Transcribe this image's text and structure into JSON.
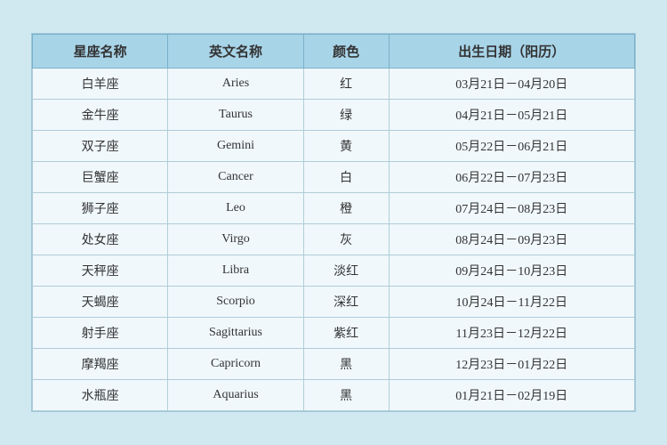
{
  "table": {
    "headers": [
      {
        "key": "chinese",
        "label": "星座名称"
      },
      {
        "key": "english",
        "label": "英文名称"
      },
      {
        "key": "color",
        "label": "颜色"
      },
      {
        "key": "date",
        "label": "出生日期（阳历）"
      }
    ],
    "rows": [
      {
        "chinese": "白羊座",
        "english": "Aries",
        "color": "红",
        "date": "03月21日－04月20日"
      },
      {
        "chinese": "金牛座",
        "english": "Taurus",
        "color": "绿",
        "date": "04月21日－05月21日"
      },
      {
        "chinese": "双子座",
        "english": "Gemini",
        "color": "黄",
        "date": "05月22日－06月21日"
      },
      {
        "chinese": "巨蟹座",
        "english": "Cancer",
        "color": "白",
        "date": "06月22日－07月23日"
      },
      {
        "chinese": "狮子座",
        "english": "Leo",
        "color": "橙",
        "date": "07月24日－08月23日"
      },
      {
        "chinese": "处女座",
        "english": "Virgo",
        "color": "灰",
        "date": "08月24日－09月23日"
      },
      {
        "chinese": "天秤座",
        "english": "Libra",
        "color": "淡红",
        "date": "09月24日－10月23日"
      },
      {
        "chinese": "天蝎座",
        "english": "Scorpio",
        "color": "深红",
        "date": "10月24日－11月22日"
      },
      {
        "chinese": "射手座",
        "english": "Sagittarius",
        "color": "紫红",
        "date": "11月23日－12月22日"
      },
      {
        "chinese": "摩羯座",
        "english": "Capricorn",
        "color": "黑",
        "date": "12月23日－01月22日"
      },
      {
        "chinese": "水瓶座",
        "english": "Aquarius",
        "color": "黑",
        "date": "01月21日－02月19日"
      }
    ]
  }
}
